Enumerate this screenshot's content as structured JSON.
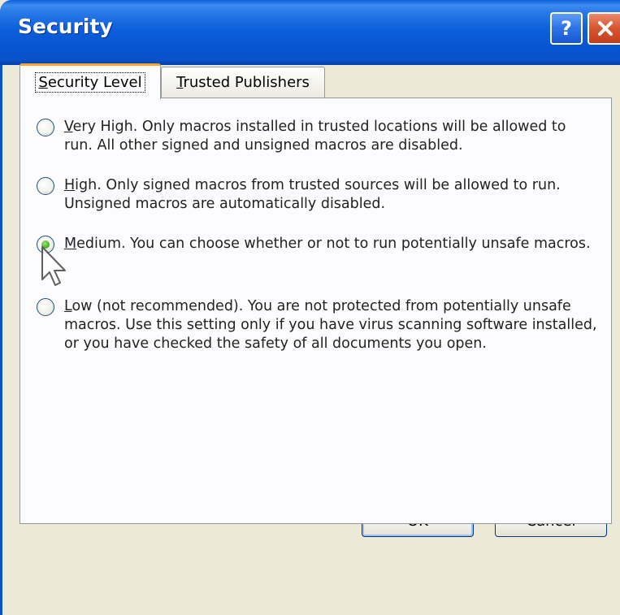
{
  "window": {
    "title": "Security"
  },
  "titlebar": {
    "help_label": "?",
    "help_icon": "help-icon",
    "close_icon": "close-icon"
  },
  "tabs": [
    {
      "label_prefix": "",
      "accel": "S",
      "label_rest": "ecurity Level",
      "selected": true
    },
    {
      "label_prefix": "",
      "accel": "T",
      "label_rest": "rusted Publishers",
      "selected": false
    }
  ],
  "security_levels": [
    {
      "accel": "V",
      "rest": "ery High. Only macros installed in trusted locations will be allowed to run. All other signed and unsigned macros are disabled.",
      "checked": false
    },
    {
      "accel": "H",
      "rest": "igh. Only signed macros from trusted sources will be allowed to run. Unsigned macros are automatically disabled.",
      "checked": false
    },
    {
      "accel": "M",
      "rest": "edium. You can choose whether or not to run potentially unsafe macros.",
      "checked": true
    },
    {
      "accel": "L",
      "rest": "ow (not recommended). You are not protected from potentially unsafe macros. Use this setting only if you have virus scanning software installed, or you have checked the safety of all documents you open.",
      "checked": false
    }
  ],
  "buttons": {
    "ok_label": "OK",
    "cancel_label": "Cancel"
  },
  "colors": {
    "titlebar": "#0a52c8",
    "close_button": "#d65531",
    "tab_highlight": "#f5a830",
    "radio_selected": "#4fb52a"
  },
  "cursor_icon": "mouse-pointer-icon"
}
